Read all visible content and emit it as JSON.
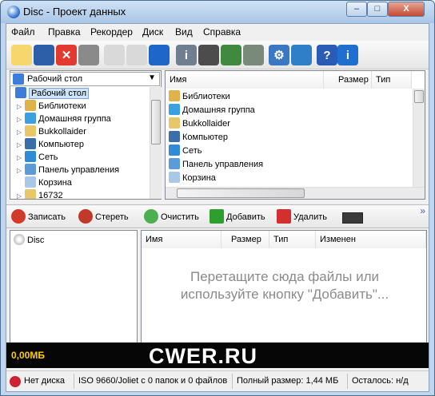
{
  "window": {
    "title": "Disc - Проект данных",
    "min_glyph": "‒",
    "max_glyph": "□",
    "close_glyph": "X"
  },
  "menu": [
    "Файл",
    "Правка",
    "Рекордер",
    "Диск",
    "Вид",
    "Справка"
  ],
  "toolbar": [
    {
      "icon": "new-project-icon",
      "glyph": "",
      "color": "#f5d76e"
    },
    {
      "icon": "save-icon",
      "glyph": "",
      "color": "#2d5fa8"
    },
    {
      "icon": "delete-icon",
      "glyph": "✕",
      "color": "#ffffff"
    },
    {
      "icon": "print-icon",
      "glyph": "",
      "color": "#8a8a8a"
    },
    {
      "icon": "erase-disc-icon",
      "glyph": "",
      "color": "#d9d9d9"
    },
    {
      "icon": "burn-disc-icon",
      "glyph": "",
      "color": "#d9d9d9"
    },
    {
      "icon": "disc-info-icon",
      "glyph": "",
      "color": "#1e66c8"
    },
    {
      "icon": "drive-info-icon",
      "glyph": "i",
      "color": "#6f7f8f"
    },
    {
      "icon": "eject-icon",
      "glyph": "",
      "color": "#4c4c4c"
    },
    {
      "icon": "play-disc-icon",
      "glyph": "",
      "color": "#3f8a3f"
    },
    {
      "icon": "refresh-icon",
      "glyph": "",
      "color": "#7a8a7a"
    },
    {
      "icon": "settings-icon",
      "glyph": "⚙",
      "color": "#3a78c2"
    },
    {
      "icon": "update-icon",
      "glyph": "",
      "color": "#2f7fc8"
    },
    {
      "icon": "help-icon",
      "glyph": "?",
      "color": "#2a5bb5"
    },
    {
      "icon": "about-icon",
      "glyph": "i",
      "color": "#1f6fd0"
    }
  ],
  "location": {
    "value": "Рабочий стол"
  },
  "tree": [
    {
      "label": "Рабочий стол",
      "icon": "desktop-icon",
      "color": "#3b7dd8",
      "selected": true,
      "expander": ""
    },
    {
      "label": "Библиотеки",
      "icon": "libraries-icon",
      "color": "#e0b24a",
      "expander": "▷"
    },
    {
      "label": "Домашняя группа",
      "icon": "homegroup-icon",
      "color": "#3aa0e0",
      "expander": "▷"
    },
    {
      "label": "Bukkollaider",
      "icon": "user-folder-icon",
      "color": "#e8c66a",
      "expander": "▷"
    },
    {
      "label": "Компьютер",
      "icon": "computer-icon",
      "color": "#3a6ea8",
      "expander": "▷"
    },
    {
      "label": "Сеть",
      "icon": "network-icon",
      "color": "#2f8ad8",
      "expander": "▷"
    },
    {
      "label": "Панель управления",
      "icon": "control-panel-icon",
      "color": "#5a9bd8",
      "expander": "▷"
    },
    {
      "label": "Корзина",
      "icon": "recycle-bin-icon",
      "color": "#a9c8e8",
      "expander": ""
    },
    {
      "label": "16732",
      "icon": "folder-icon",
      "color": "#e8c66a",
      "expander": "▷"
    }
  ],
  "explorer": {
    "columns": [
      "Имя",
      "Размер",
      "Тип"
    ],
    "items": [
      {
        "label": "Библиотеки",
        "icon": "libraries-icon",
        "color": "#e0b24a"
      },
      {
        "label": "Домашняя группа",
        "icon": "homegroup-icon",
        "color": "#3aa0e0"
      },
      {
        "label": "Bukkollaider",
        "icon": "user-folder-icon",
        "color": "#e8c66a"
      },
      {
        "label": "Компьютер",
        "icon": "computer-icon",
        "color": "#3a6ea8"
      },
      {
        "label": "Сеть",
        "icon": "network-icon",
        "color": "#2f8ad8"
      },
      {
        "label": "Панель управления",
        "icon": "control-panel-icon",
        "color": "#5a9bd8"
      },
      {
        "label": "Корзина",
        "icon": "recycle-bin-icon",
        "color": "#a9c8e8"
      }
    ]
  },
  "actions": [
    {
      "label": "Записать",
      "icon": "burn-icon",
      "color": "#d23b2a",
      "name": "burn-button"
    },
    {
      "label": "Стереть",
      "icon": "erase-icon",
      "color": "#c0392b",
      "name": "erase-button"
    },
    {
      "label": "Очистить",
      "icon": "clear-icon",
      "color": "#4caf50",
      "name": "clear-button"
    },
    {
      "label": "Добавить",
      "icon": "add-icon",
      "color": "#2e9e2e",
      "name": "add-button"
    },
    {
      "label": "Удалить",
      "icon": "remove-icon",
      "color": "#d32f2f",
      "name": "remove-button"
    }
  ],
  "more_glyph": "»",
  "project": {
    "root": "Disc",
    "columns": [
      "Имя",
      "Размер",
      "Тип",
      "Изменен"
    ],
    "hint_line1": "Перетащите сюда файлы или",
    "hint_line2": "используйте кнопку \"Добавить\"..."
  },
  "capacity": {
    "used": "0,00МБ",
    "fill_fraction": 0,
    "bar_color": "#ffcc00",
    "watermark": "CWER.RU"
  },
  "status": {
    "disk": "Нет диска",
    "fs": "ISO 9660/Joliet с 0 папок и 0 файлов",
    "total": "Полный размер: 1,44 МБ",
    "remaining": "Осталось: н/д"
  }
}
